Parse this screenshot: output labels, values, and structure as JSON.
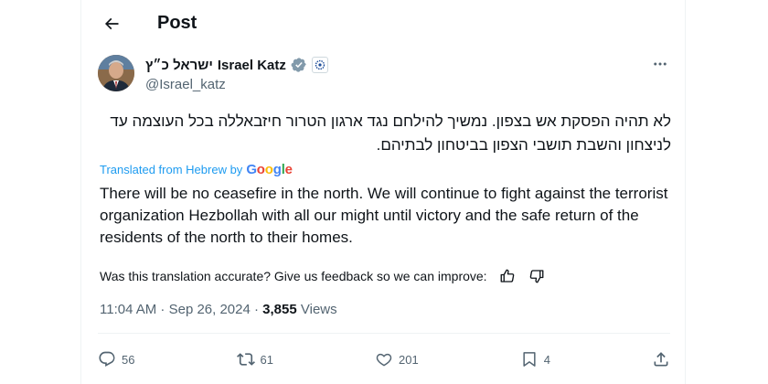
{
  "header": {
    "title": "Post"
  },
  "author": {
    "display_name_hebrew": "ישראל כ״ץ",
    "display_name": "Israel Katz",
    "handle": "@Israel_katz"
  },
  "post": {
    "text_hebrew": "לא תהיה הפסקת אש בצפון. נמשיך להילחם נגד ארגון הטרור חיזבאללה בכל העוצמה עד לניצחון והשבת תושבי הצפון בביטחון לבתיהם.",
    "translated_label": "Translated from Hebrew by",
    "translator": "Google",
    "text_english": "There will be no ceasefire in the north. We will continue to fight against the terrorist organization Hezbollah with all our might until victory and the safe return of the residents of the north to their homes.",
    "feedback_prompt": "Was this translation accurate? Give us feedback so we can improve:",
    "timestamp": "11:04 AM · Sep 26, 2024 · ",
    "views_count": "3,855",
    "views_label": " Views"
  },
  "actions": {
    "replies": "56",
    "reposts": "61",
    "likes": "201",
    "bookmarks": "4"
  },
  "colors": {
    "accent": "#1d9bf0",
    "muted": "#536471",
    "text": "#0f1419"
  }
}
